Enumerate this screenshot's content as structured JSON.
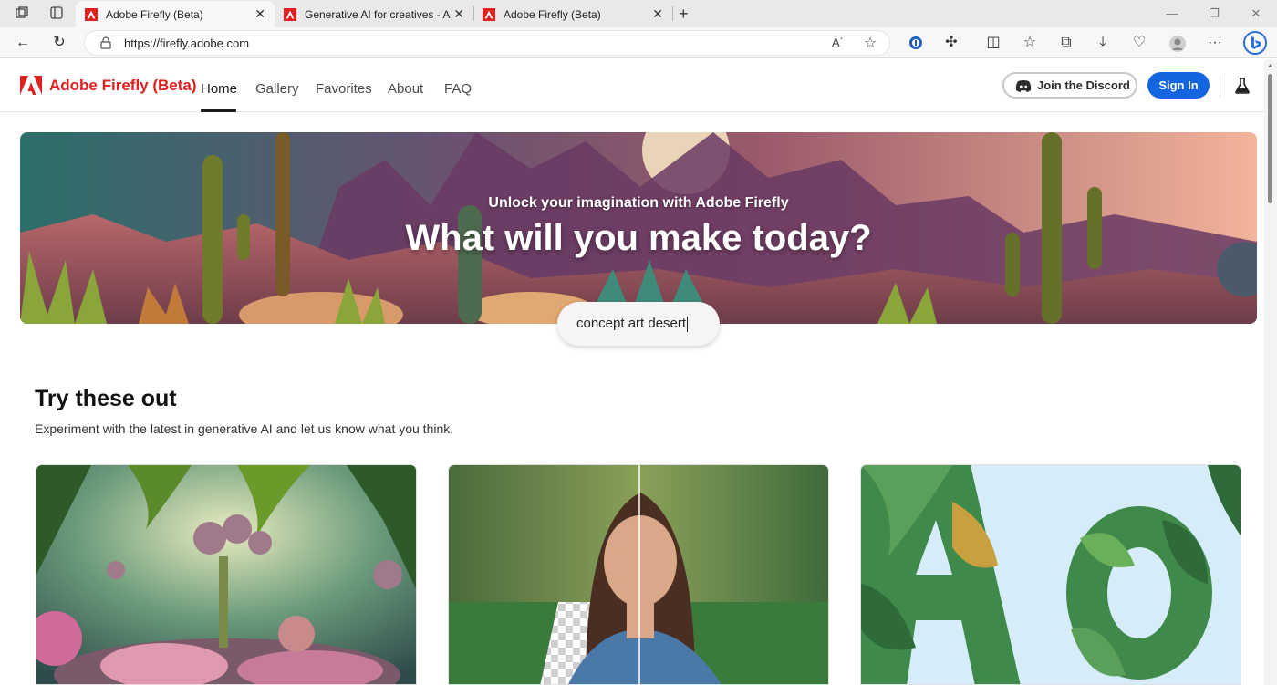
{
  "browser": {
    "tabs": [
      {
        "title": "Adobe Firefly (Beta)",
        "active": true
      },
      {
        "title": "Generative AI for creatives - Ado",
        "active": false
      },
      {
        "title": "Adobe Firefly (Beta)",
        "active": false
      }
    ],
    "url": "https://firefly.adobe.com"
  },
  "header": {
    "brand": "Adobe Firefly (Beta)",
    "nav": [
      "Home",
      "Gallery",
      "Favorites",
      "About",
      "FAQ"
    ],
    "active_nav": "Home",
    "discord_label": "Join the Discord",
    "signin_label": "Sign In"
  },
  "hero": {
    "subtitle": "Unlock your imagination with Adobe Firefly",
    "title": "What will you make today?",
    "prompt_value": "concept art desert"
  },
  "section": {
    "title": "Try these out",
    "subtitle": "Experiment with the latest in generative AI and let us know what you think."
  },
  "colors": {
    "brand_red": "#e01f1f",
    "signin_blue": "#1366e0"
  },
  "icons": [
    "back-icon",
    "refresh-icon",
    "lock-icon",
    "read-aloud-icon",
    "favorite-star-icon",
    "extension-icon",
    "split-screen-icon",
    "favorites-icon",
    "collections-icon",
    "download-icon",
    "health-icon",
    "profile-icon",
    "more-icon",
    "bing-icon",
    "discord-icon",
    "flask-icon"
  ]
}
